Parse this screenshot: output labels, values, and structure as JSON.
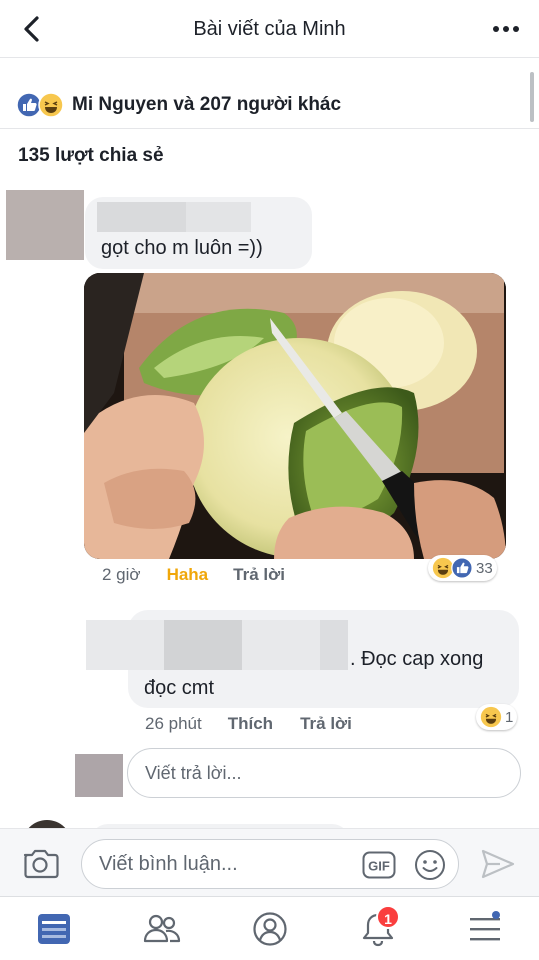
{
  "header": {
    "title": "Bài viết của Minh",
    "back_icon": "chevron-left-icon",
    "more_icon": "more-horizontal-icon"
  },
  "post_stats": {
    "reactions_text": "Mi Nguyen và 207 người khác",
    "reaction_icons": [
      "like-icon",
      "haha-icon"
    ],
    "shares_text": "135 lượt chia sẻ"
  },
  "comments": [
    {
      "text": "gọt cho m luôn =))",
      "image": "mango-peeling-photo",
      "time": "2 giờ",
      "reaction_label": "Haha",
      "reply_label": "Trả lời",
      "reaction_count": "33"
    },
    {
      "text_line1": ". Đọc cap xong",
      "text_line2": "đọc cmt",
      "time": "26 phút",
      "like_label": "Thích",
      "reply_label": "Trả lời",
      "reaction_count": "1"
    }
  ],
  "reply_box": {
    "placeholder": "Viết trả lời..."
  },
  "composer": {
    "placeholder": "Viết bình luận...",
    "gif_label": "GIF"
  },
  "tabbar": {
    "items": [
      "news-feed-icon",
      "friends-icon",
      "profile-icon",
      "notifications-icon",
      "menu-icon"
    ],
    "notifications_badge": "1"
  },
  "colors": {
    "facebook_blue": "#4267b2",
    "haha_yellow": "#f0a70a",
    "text_primary": "#1d2129",
    "text_secondary": "#606770",
    "bubble_bg": "#f1f2f4",
    "badge_red": "#fa3e3e"
  }
}
